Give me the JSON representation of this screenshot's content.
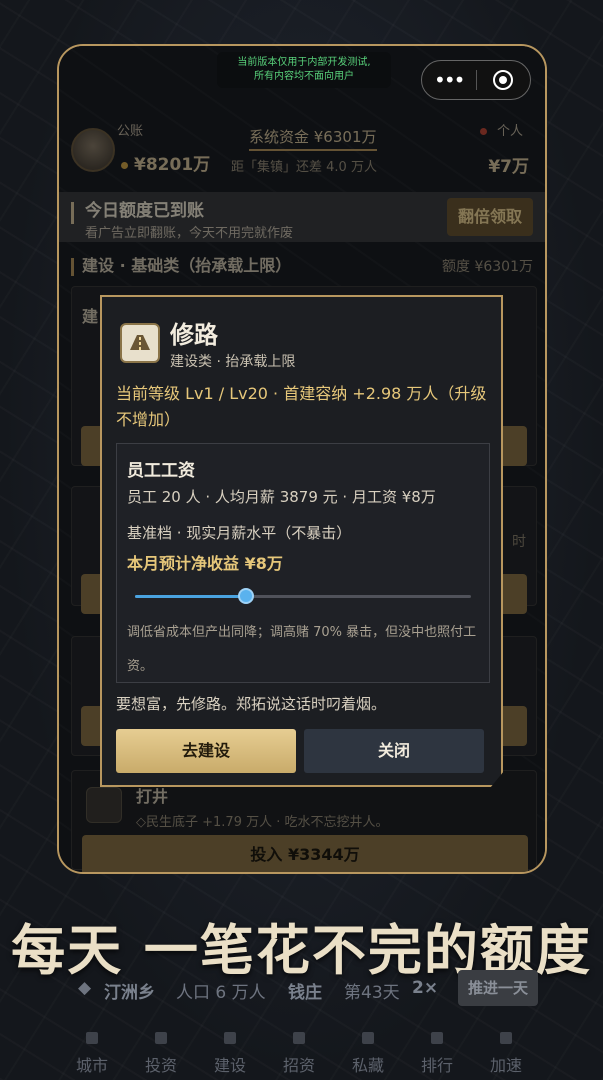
{
  "test_banner": {
    "line1": "当前版本仅用于内部开发测试,",
    "line2": "所有内容均不面向用户"
  },
  "header": {
    "public_label": "公账",
    "public_value": "¥8201万",
    "system_fund": "系统资金 ¥6301万",
    "system_sub": "距「集镇」还差 4.0 万人",
    "private_label": "个人",
    "private_value": "¥7万"
  },
  "notice": {
    "title": "今日额度已到账",
    "subtitle": "看广告立即翻账，今天不用完就作废",
    "button": "翻倍领取"
  },
  "section": {
    "title": "建设 · 基础类（抬承载上限）",
    "quota": "额度 ¥6301万"
  },
  "behind": {
    "card_title_fragment": "建",
    "row_right": "时"
  },
  "well": {
    "title": "打井",
    "subtitle": "◇民生底子 +1.79 万人 · 吃水不忘挖井人。",
    "button": "投入 ¥3344万"
  },
  "modal": {
    "icon": "road-icon",
    "title": "修路",
    "subtitle": "建设类 · 抬承载上限",
    "level_text": "当前等级 Lv1 / Lv20 · 首建容纳 +2.98 万人（升级不增加）",
    "salary": {
      "title": "员工工资",
      "line": "员工 20 人 · 人均月薪 3879 元 · 月工资 ¥8万",
      "tier": "基准档 · 现实月薪水平（不暴击）",
      "net": "本月预计净收益 ¥8万",
      "slider_level": 0.33,
      "note": "调低省成本但产出同降；调高赌 70% 暴击，但没中也照付工资。"
    },
    "quote": "要想富，先修路。郑拓说这话时叼着烟。",
    "build_button": "去建设",
    "close_button": "关闭"
  },
  "slogan": "每天 一笔花不完的额度",
  "status": {
    "town": "汀洲乡",
    "population": "人口 6 万人",
    "title": "钱庄",
    "day": "第43天",
    "speed": "2×",
    "advance": "推进一天"
  },
  "tabs": [
    "城市",
    "投资",
    "建设",
    "招资",
    "私藏",
    "排行",
    "加速"
  ],
  "colors": {
    "gold": "#b8975f",
    "accent_text": "#e6c77a",
    "slider": "#4aa3e0"
  }
}
